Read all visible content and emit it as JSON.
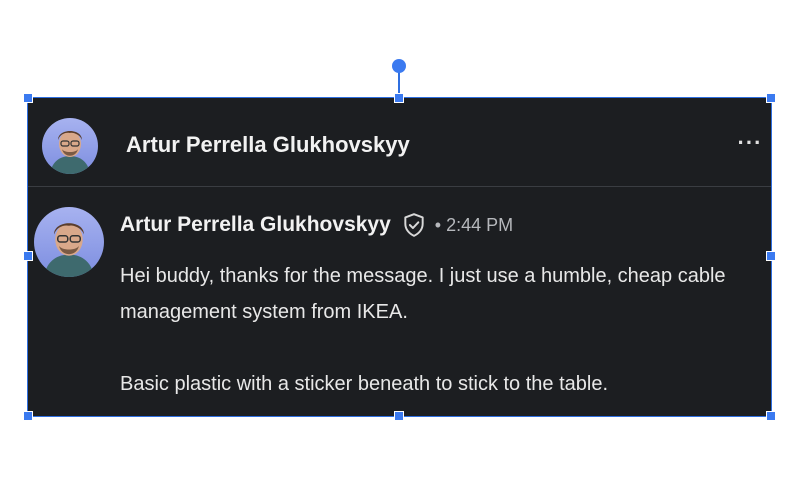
{
  "header": {
    "name": "Artur Perrella Glukhovskyy",
    "avatar_icon": "person-avatar",
    "more_icon": "ellipsis-icon",
    "more_label": "···"
  },
  "message": {
    "author": "Artur Perrella Glukhovskyy",
    "verified_icon": "shield-check-icon",
    "time": "• 2:44 PM",
    "paragraphs": [
      "Hei buddy, thanks for the message. I just use a humble, cheap cable management system from IKEA.",
      "Basic plastic with a sticker beneath to stick to the table."
    ]
  },
  "colors": {
    "card_background": "#1c1e21",
    "selection_accent": "#3b7af0",
    "text_primary": "#f2f2f2",
    "text_secondary": "#b6b8bc"
  }
}
